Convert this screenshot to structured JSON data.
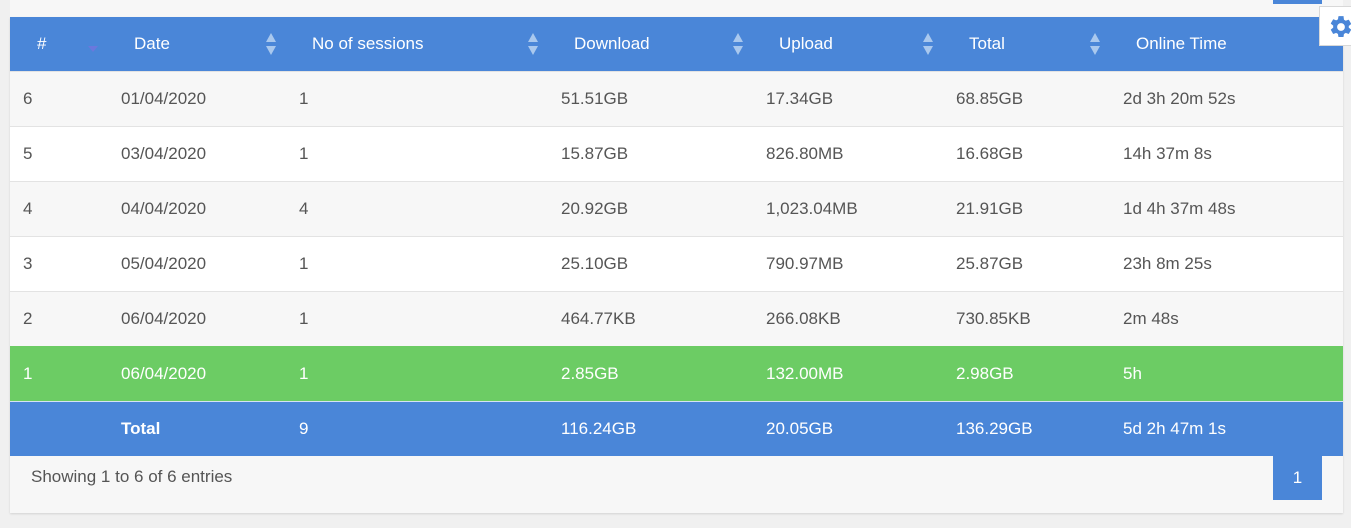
{
  "table": {
    "columns": [
      {
        "key": "index",
        "label": "#"
      },
      {
        "key": "date",
        "label": "Date"
      },
      {
        "key": "sessions",
        "label": "No of sessions"
      },
      {
        "key": "download",
        "label": "Download"
      },
      {
        "key": "upload",
        "label": "Upload"
      },
      {
        "key": "total",
        "label": "Total"
      },
      {
        "key": "online",
        "label": "Online Time"
      }
    ],
    "rows": [
      {
        "index": "6",
        "date": "01/04/2020",
        "sessions": "1",
        "download": "51.51GB",
        "upload": "17.34GB",
        "total": "68.85GB",
        "online": "2d 3h 20m 52s"
      },
      {
        "index": "5",
        "date": "03/04/2020",
        "sessions": "1",
        "download": "15.87GB",
        "upload": "826.80MB",
        "total": "16.68GB",
        "online": "14h 37m 8s"
      },
      {
        "index": "4",
        "date": "04/04/2020",
        "sessions": "4",
        "download": "20.92GB",
        "upload": "1,023.04MB",
        "total": "21.91GB",
        "online": "1d 4h 37m 48s"
      },
      {
        "index": "3",
        "date": "05/04/2020",
        "sessions": "1",
        "download": "25.10GB",
        "upload": "790.97MB",
        "total": "25.87GB",
        "online": "23h 8m 25s"
      },
      {
        "index": "2",
        "date": "06/04/2020",
        "sessions": "1",
        "download": "464.77KB",
        "upload": "266.08KB",
        "total": "730.85KB",
        "online": "2m 48s"
      },
      {
        "index": "1",
        "date": "06/04/2020",
        "sessions": "1",
        "download": "2.85GB",
        "upload": "132.00MB",
        "total": "2.98GB",
        "online": "5h"
      }
    ],
    "totals": {
      "label": "Total",
      "sessions": "9",
      "download": "116.24GB",
      "upload": "20.05GB",
      "total": "136.29GB",
      "online": "5d 2h 47m 1s"
    }
  },
  "footer": {
    "info": "Showing 1 to 6 of 6 entries",
    "page": "1"
  },
  "icons": {
    "settings": "gear-icon",
    "sort": "sort-arrows-icon"
  },
  "colors": {
    "header": "#4a86d8",
    "highlight_row": "#6ccc64",
    "total_row": "#4a86d8"
  }
}
